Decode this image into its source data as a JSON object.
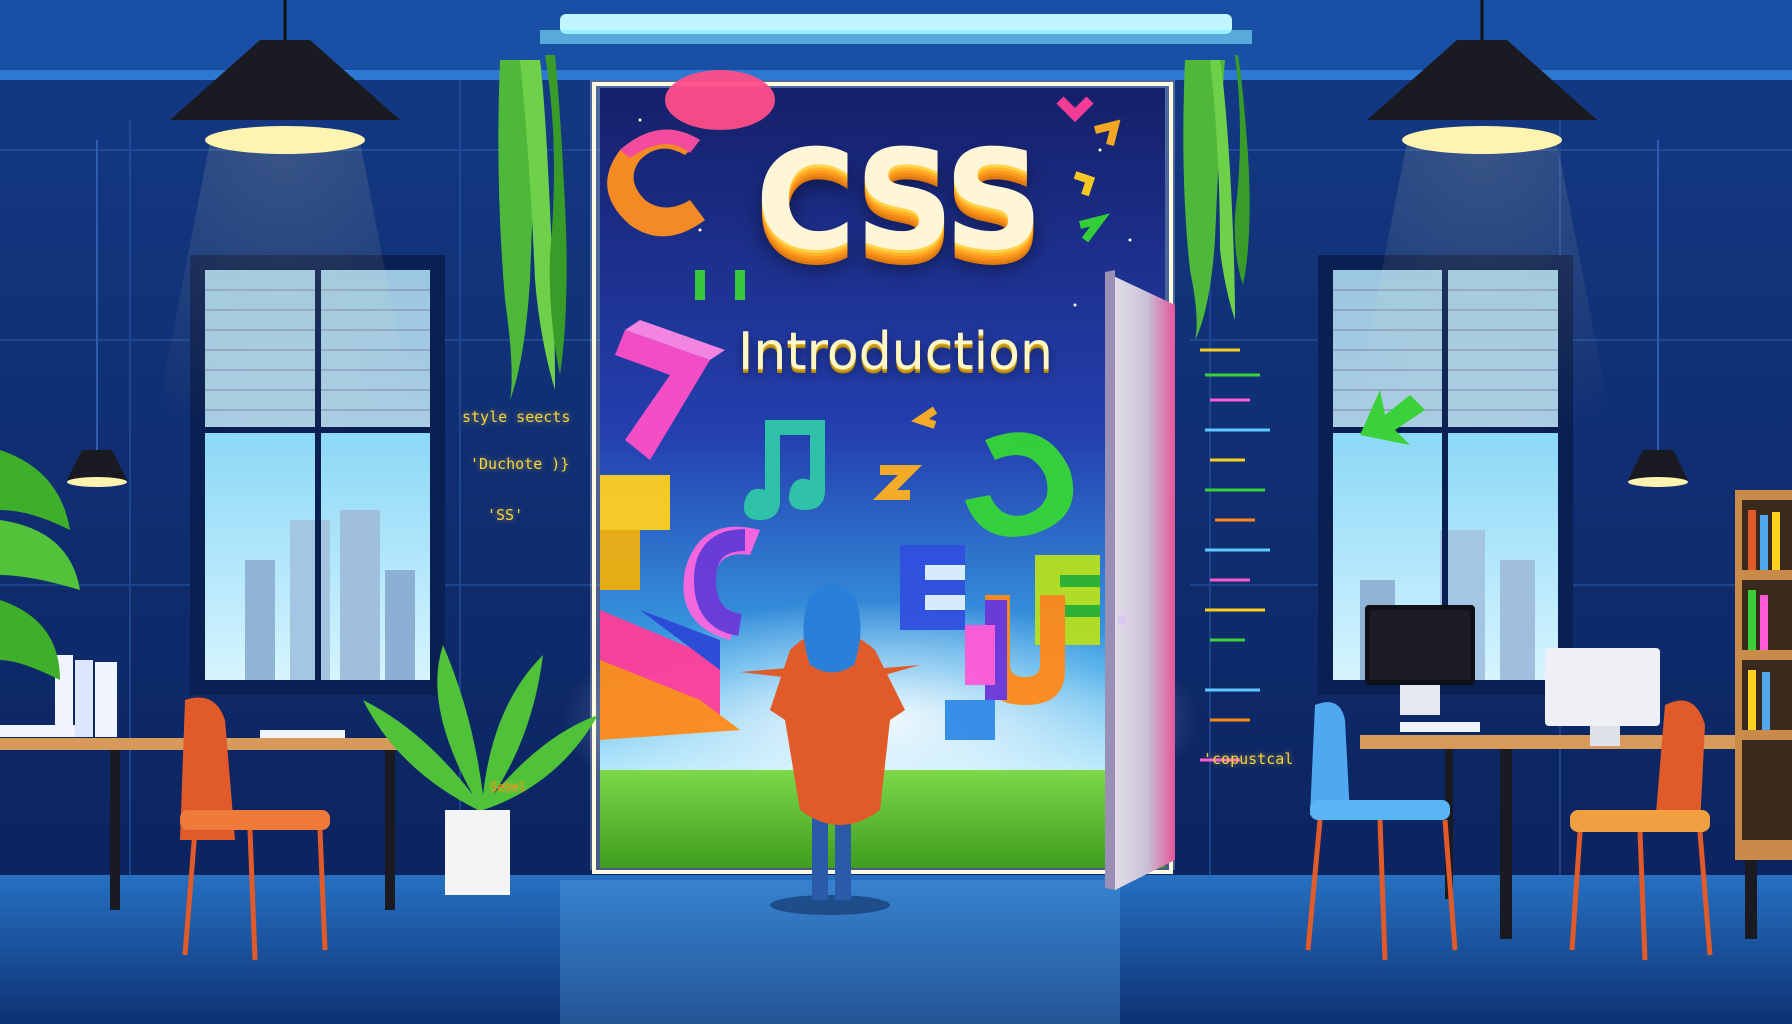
{
  "scene": {
    "title": "CSS",
    "subtitle": "Introduction",
    "left_wall_code": [
      "style seects",
      "'Duchote )}",
      "'SS'"
    ],
    "right_wall_code": [
      "'copustcal"
    ],
    "plant_pot_text": "Sebel"
  },
  "colors": {
    "wall": "#0f2a6a",
    "floor": "#1e5fb0",
    "sky": "#1a2f8a",
    "grass": "#5fc23a",
    "accent_yellow": "#ffcf3a",
    "ceiling_light": "#7fe9ff"
  }
}
